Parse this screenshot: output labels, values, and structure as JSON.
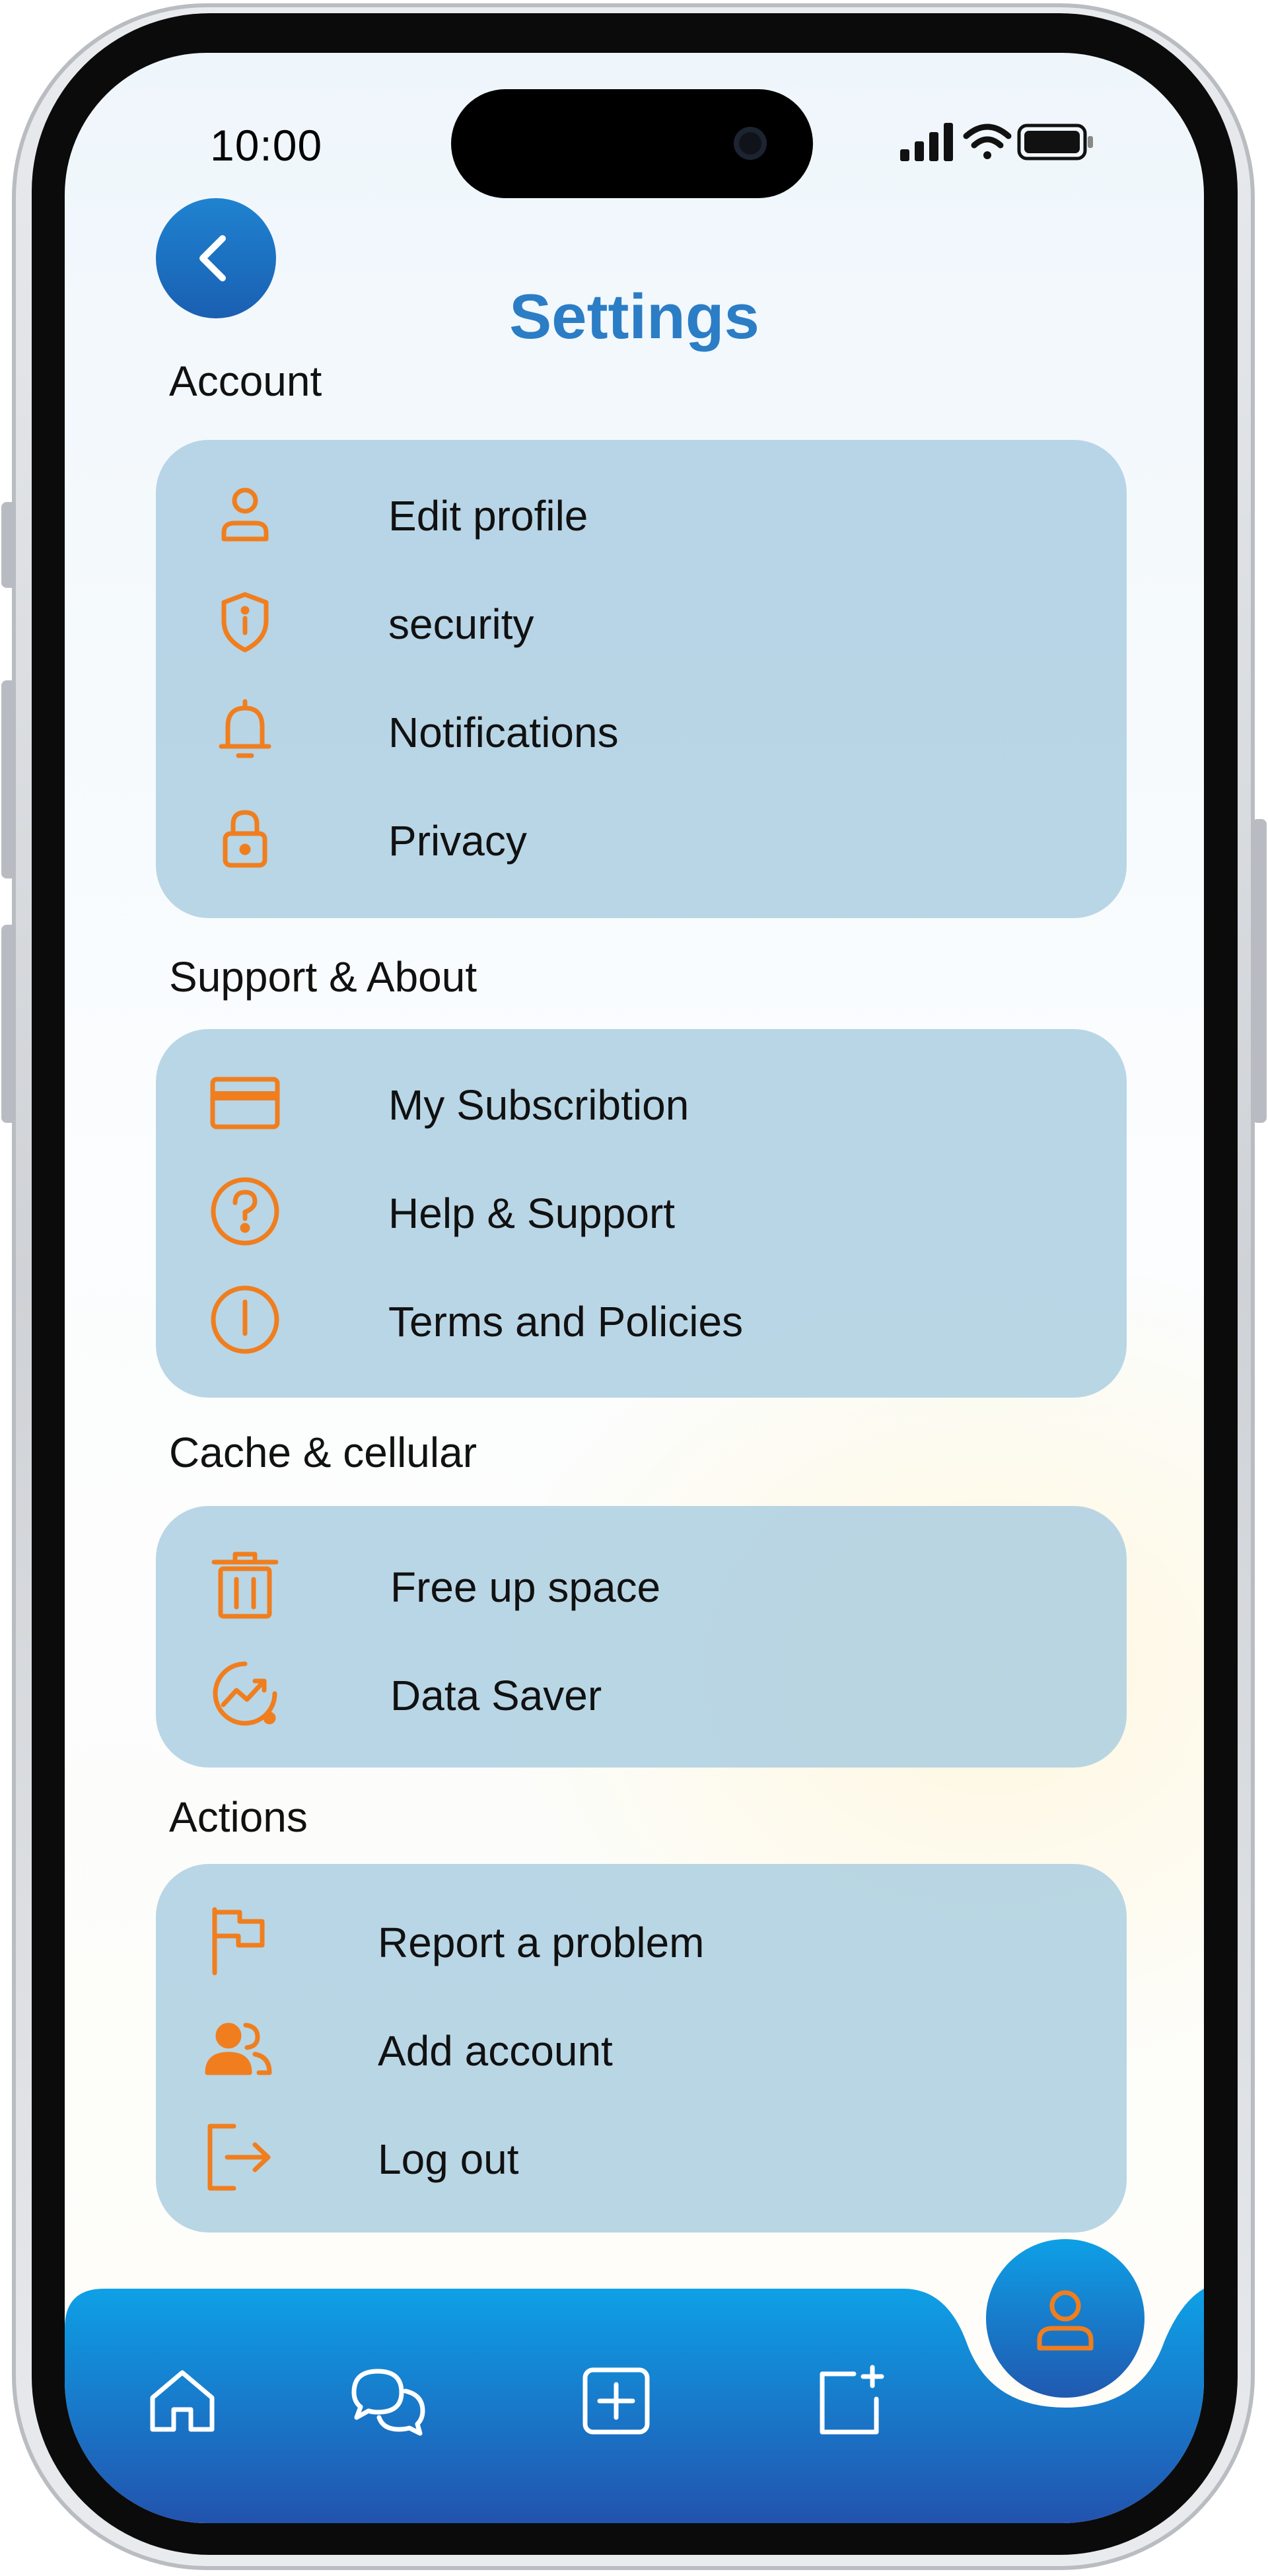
{
  "status_bar": {
    "time": "10:00"
  },
  "header": {
    "title": "Settings"
  },
  "sections": [
    {
      "title": "Account",
      "items": [
        {
          "icon": "user-icon",
          "label": "Edit profile"
        },
        {
          "icon": "shield-icon",
          "label": "security"
        },
        {
          "icon": "bell-icon",
          "label": "Notifications"
        },
        {
          "icon": "lock-icon",
          "label": "Privacy"
        }
      ]
    },
    {
      "title": "Support & About",
      "items": [
        {
          "icon": "credit-card-icon",
          "label": "My Subscribtion"
        },
        {
          "icon": "help-circle-icon",
          "label": "Help & Support"
        },
        {
          "icon": "info-circle-icon",
          "label": "Terms and Policies"
        }
      ]
    },
    {
      "title": "Cache & cellular",
      "items": [
        {
          "icon": "trash-icon",
          "label": "Free up space"
        },
        {
          "icon": "chart-trend-icon",
          "label": "Data Saver"
        }
      ]
    },
    {
      "title": "Actions",
      "items": [
        {
          "icon": "flag-icon",
          "label": "Report a problem"
        },
        {
          "icon": "users-icon",
          "label": "Add account"
        },
        {
          "icon": "logout-icon",
          "label": "Log out"
        }
      ]
    }
  ],
  "tabbar": {
    "items": [
      "home-icon",
      "chat-icon",
      "add-square-icon",
      "new-post-icon",
      "profile-icon"
    ],
    "active": "profile-icon"
  },
  "colors": {
    "accent": "#f07e1e",
    "title": "#2b7dc5",
    "card": "#b2d2e6",
    "nav_start": "#0ea0e6",
    "nav_end": "#2253ae"
  }
}
